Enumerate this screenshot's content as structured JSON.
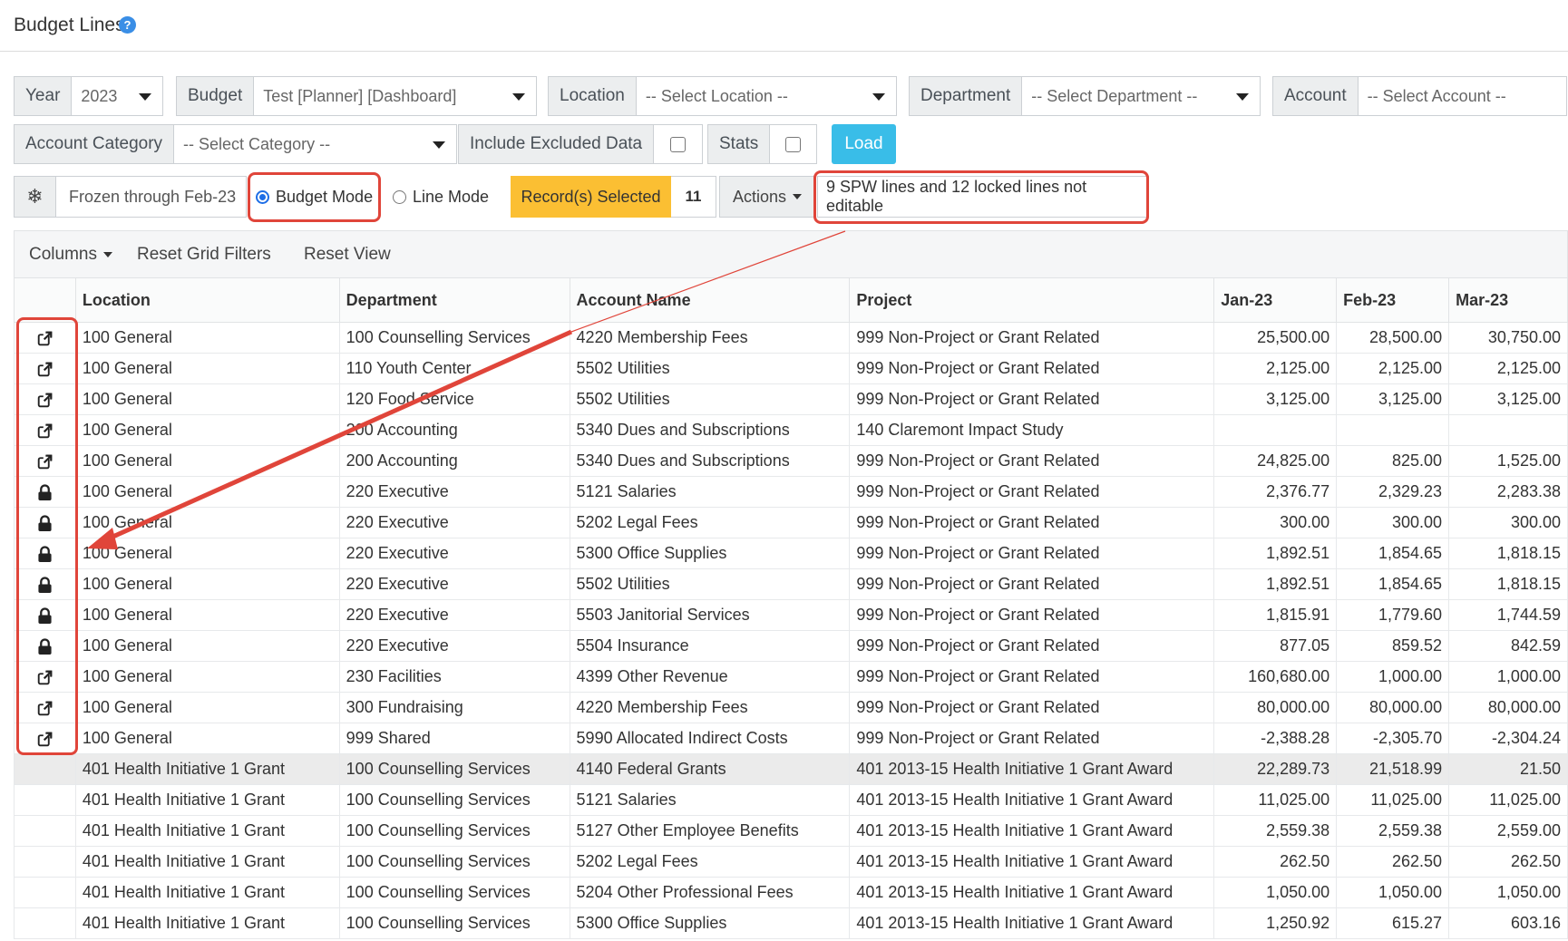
{
  "page": {
    "title": "Budget Lines",
    "help": "?"
  },
  "filters": {
    "year": {
      "label": "Year",
      "value": "2023"
    },
    "budget": {
      "label": "Budget",
      "value": "Test [Planner] [Dashboard]"
    },
    "location": {
      "label": "Location",
      "value": "-- Select Location --"
    },
    "department": {
      "label": "Department",
      "value": "-- Select Department --"
    },
    "account": {
      "label": "Account",
      "value": "-- Select Account --"
    },
    "account_category": {
      "label": "Account Category",
      "value": "-- Select Category --"
    },
    "include_excluded": {
      "label": "Include Excluded Data",
      "checked": false
    },
    "stats": {
      "label": "Stats",
      "checked": false
    },
    "load_label": "Load"
  },
  "modebar": {
    "freeze_icon": "snowflake-icon",
    "frozen_label": "Frozen through Feb-23",
    "budget_mode": "Budget Mode",
    "line_mode": "Line Mode",
    "selected_mode": "Budget Mode",
    "records_selected": "Record(s) Selected",
    "records_count": "11",
    "actions": "Actions",
    "notice": "9 SPW lines and 12 locked lines not editable"
  },
  "toolbar": {
    "columns": "Columns",
    "reset_filters": "Reset Grid Filters",
    "reset_view": "Reset View"
  },
  "colors": {
    "accent": "#39bde8",
    "selected": "#fbbf33",
    "highlight": "#e0453a"
  },
  "grid": {
    "columns": [
      "Location",
      "Department",
      "Account Name",
      "Project",
      "Jan-23",
      "Feb-23",
      "Mar-23"
    ],
    "rows": [
      {
        "icon": "edit",
        "loc": "100 General",
        "dept": "100 Counselling Services",
        "acct": "4220 Membership Fees",
        "proj": "999 Non-Project or Grant Related",
        "jan": "25,500.00",
        "feb": "28,500.00",
        "mar": "30,750.00"
      },
      {
        "icon": "edit",
        "loc": "100 General",
        "dept": "110 Youth Center",
        "acct": "5502 Utilities",
        "proj": "999 Non-Project or Grant Related",
        "jan": "2,125.00",
        "feb": "2,125.00",
        "mar": "2,125.00"
      },
      {
        "icon": "edit",
        "loc": "100 General",
        "dept": "120 Food Service",
        "acct": "5502 Utilities",
        "proj": "999 Non-Project or Grant Related",
        "jan": "3,125.00",
        "feb": "3,125.00",
        "mar": "3,125.00"
      },
      {
        "icon": "edit",
        "loc": "100 General",
        "dept": "200 Accounting",
        "acct": "5340 Dues and Subscriptions",
        "proj": "140 Claremont Impact Study",
        "jan": "",
        "feb": "",
        "mar": ""
      },
      {
        "icon": "edit",
        "loc": "100 General",
        "dept": "200 Accounting",
        "acct": "5340 Dues and Subscriptions",
        "proj": "999 Non-Project or Grant Related",
        "jan": "24,825.00",
        "feb": "825.00",
        "mar": "1,525.00"
      },
      {
        "icon": "lock",
        "loc": "100 General",
        "dept": "220 Executive",
        "acct": "5121 Salaries",
        "proj": "999 Non-Project or Grant Related",
        "jan": "2,376.77",
        "feb": "2,329.23",
        "mar": "2,283.38"
      },
      {
        "icon": "lock",
        "loc": "100 General",
        "dept": "220 Executive",
        "acct": "5202 Legal Fees",
        "proj": "999 Non-Project or Grant Related",
        "jan": "300.00",
        "feb": "300.00",
        "mar": "300.00"
      },
      {
        "icon": "lock",
        "loc": "100 General",
        "dept": "220 Executive",
        "acct": "5300 Office Supplies",
        "proj": "999 Non-Project or Grant Related",
        "jan": "1,892.51",
        "feb": "1,854.65",
        "mar": "1,818.15"
      },
      {
        "icon": "lock",
        "loc": "100 General",
        "dept": "220 Executive",
        "acct": "5502 Utilities",
        "proj": "999 Non-Project or Grant Related",
        "jan": "1,892.51",
        "feb": "1,854.65",
        "mar": "1,818.15"
      },
      {
        "icon": "lock",
        "loc": "100 General",
        "dept": "220 Executive",
        "acct": "5503 Janitorial Services",
        "proj": "999 Non-Project or Grant Related",
        "jan": "1,815.91",
        "feb": "1,779.60",
        "mar": "1,744.59"
      },
      {
        "icon": "lock",
        "loc": "100 General",
        "dept": "220 Executive",
        "acct": "5504 Insurance",
        "proj": "999 Non-Project or Grant Related",
        "jan": "877.05",
        "feb": "859.52",
        "mar": "842.59"
      },
      {
        "icon": "edit",
        "loc": "100 General",
        "dept": "230 Facilities",
        "acct": "4399 Other Revenue",
        "proj": "999 Non-Project or Grant Related",
        "jan": "160,680.00",
        "feb": "1,000.00",
        "mar": "1,000.00"
      },
      {
        "icon": "edit",
        "loc": "100 General",
        "dept": "300 Fundraising",
        "acct": "4220 Membership Fees",
        "proj": "999 Non-Project or Grant Related",
        "jan": "80,000.00",
        "feb": "80,000.00",
        "mar": "80,000.00"
      },
      {
        "icon": "edit",
        "loc": "100 General",
        "dept": "999 Shared",
        "acct": "5990 Allocated Indirect Costs",
        "proj": "999 Non-Project or Grant Related",
        "jan": "-2,388.28",
        "feb": "-2,305.70",
        "mar": "-2,304.24"
      },
      {
        "icon": "",
        "shade": true,
        "loc": "401 Health Initiative 1 Grant",
        "dept": "100 Counselling Services",
        "acct": "4140 Federal Grants",
        "proj": "401 2013-15 Health Initiative 1 Grant Award",
        "jan": "22,289.73",
        "feb": "21,518.99",
        "mar": "21.50"
      },
      {
        "icon": "",
        "loc": "401 Health Initiative 1 Grant",
        "dept": "100 Counselling Services",
        "acct": "5121 Salaries",
        "proj": "401 2013-15 Health Initiative 1 Grant Award",
        "jan": "11,025.00",
        "feb": "11,025.00",
        "mar": "11,025.00"
      },
      {
        "icon": "",
        "loc": "401 Health Initiative 1 Grant",
        "dept": "100 Counselling Services",
        "acct": "5127 Other Employee Benefits",
        "proj": "401 2013-15 Health Initiative 1 Grant Award",
        "jan": "2,559.38",
        "feb": "2,559.38",
        "mar": "2,559.00"
      },
      {
        "icon": "",
        "loc": "401 Health Initiative 1 Grant",
        "dept": "100 Counselling Services",
        "acct": "5202 Legal Fees",
        "proj": "401 2013-15 Health Initiative 1 Grant Award",
        "jan": "262.50",
        "feb": "262.50",
        "mar": "262.50"
      },
      {
        "icon": "",
        "loc": "401 Health Initiative 1 Grant",
        "dept": "100 Counselling Services",
        "acct": "5204 Other Professional Fees",
        "proj": "401 2013-15 Health Initiative 1 Grant Award",
        "jan": "1,050.00",
        "feb": "1,050.00",
        "mar": "1,050.00"
      },
      {
        "icon": "",
        "loc": "401 Health Initiative 1 Grant",
        "dept": "100 Counselling Services",
        "acct": "5300 Office Supplies",
        "proj": "401 2013-15 Health Initiative 1 Grant Award",
        "jan": "1,250.92",
        "feb": "615.27",
        "mar": "603.16"
      }
    ]
  }
}
